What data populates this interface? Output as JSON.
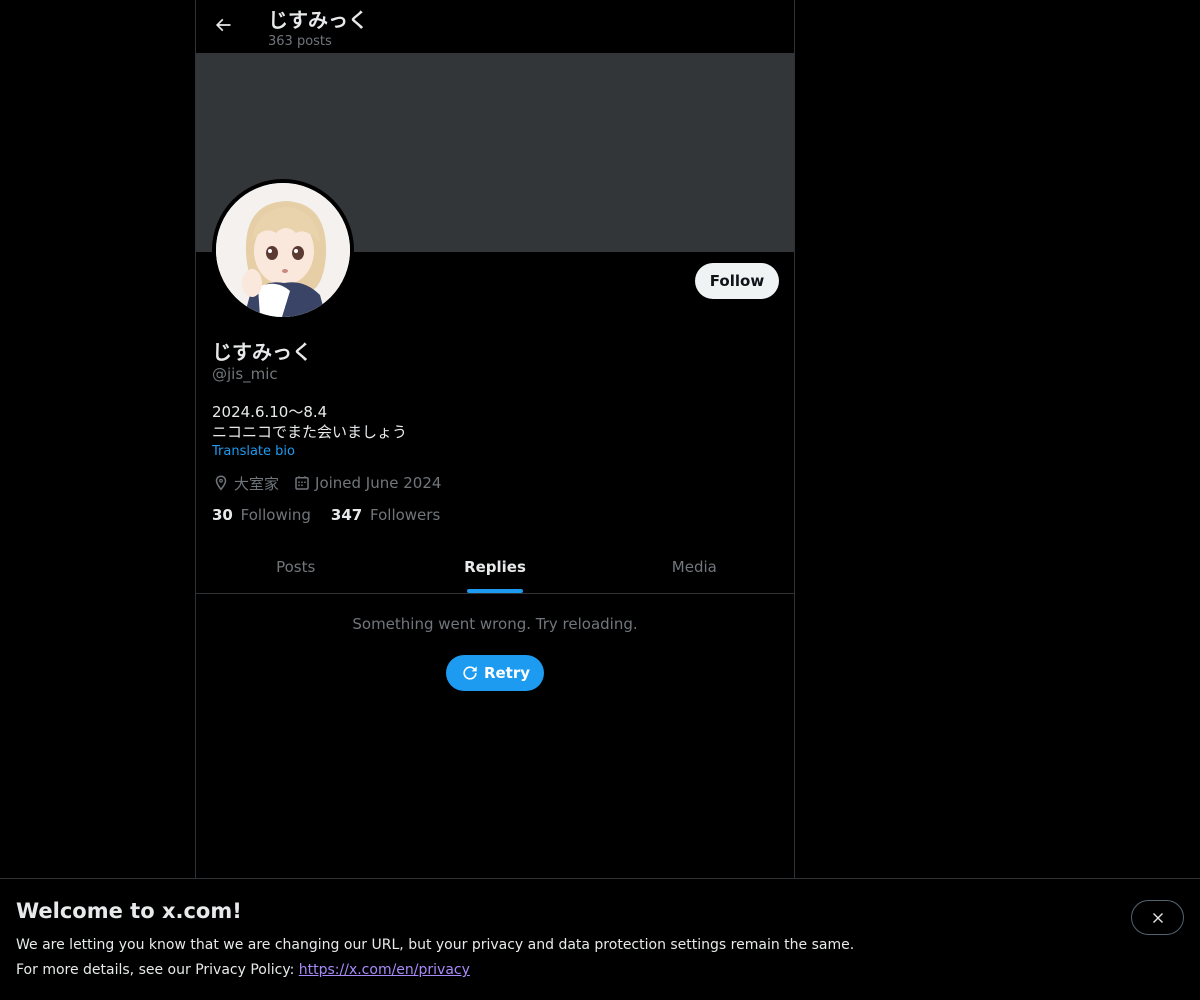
{
  "header": {
    "title": "じすみっく",
    "post_count": "363 posts",
    "back_icon": "arrow-left-icon"
  },
  "profile": {
    "display_name": "じすみっく",
    "handle": "@jis_mic",
    "bio_line1": "2024.6.10〜8.4",
    "bio_line2": "ニコニコでまた会いましょう",
    "translate_label": "Translate bio",
    "location": "大室家",
    "joined": "Joined June 2024",
    "follow_label": "Follow",
    "following_count": "30",
    "following_label": "Following",
    "followers_count": "347",
    "followers_label": "Followers",
    "avatar_icon": "anime-girl-avatar"
  },
  "tabs": [
    {
      "label": "Posts",
      "active": false
    },
    {
      "label": "Replies",
      "active": true
    },
    {
      "label": "Media",
      "active": false
    }
  ],
  "content": {
    "error_text": "Something went wrong. Try reloading.",
    "retry_label": "Retry"
  },
  "footer": {
    "title": "Welcome to x.com!",
    "line1": "We are letting you know that we are changing our URL, but your privacy and data protection settings remain the same.",
    "line2_prefix": "For more details, see our Privacy Policy:",
    "link": "https://x.com/en/privacy"
  },
  "colors": {
    "accent": "#1d9bf0",
    "background": "#000000",
    "banner": "#333639",
    "muted_text": "#71767b"
  }
}
